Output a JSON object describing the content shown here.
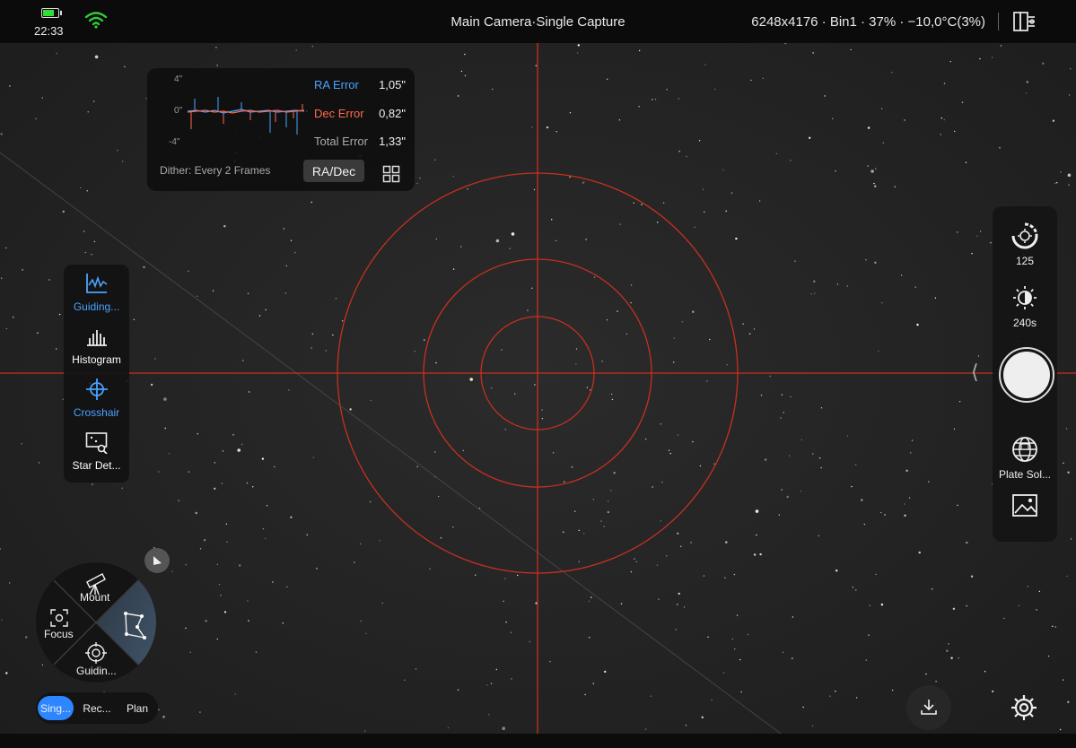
{
  "status": {
    "time": "22:33",
    "battery_level": 0.85,
    "battery_color": "#33dd33"
  },
  "header": {
    "title": "Main Camera·Single Capture",
    "camera_status": "6248x4176 · Bin1 · 37% · −10,0°C(3%)",
    "divider": "|"
  },
  "guiding": {
    "y_top": "4\"",
    "y_mid": "0\"",
    "y_bot": "-4\"",
    "ra_label": "RA Error",
    "ra_value": "1,05\"",
    "dec_label": "Dec Error",
    "dec_value": "0,82\"",
    "total_label": "Total Error",
    "total_value": "1,33\"",
    "dither": "Dither: Every 2 Frames",
    "mode_button": "RA/Dec",
    "ra_color": "#4aa3ff",
    "dec_color": "#ff6a4d"
  },
  "tools": {
    "items": [
      {
        "label": "Guiding...",
        "icon": "guiding-graph-icon",
        "active": true
      },
      {
        "label": "Histogram",
        "icon": "histogram-icon",
        "active": false
      },
      {
        "label": "Crosshair",
        "icon": "crosshair-icon",
        "active": true
      },
      {
        "label": "Star Det...",
        "icon": "star-detect-icon",
        "active": false
      }
    ]
  },
  "capture": {
    "gain": "125",
    "exposure": "240s",
    "plate_solve": "Plate Sol..."
  },
  "wheel": {
    "mount": "Mount",
    "focus": "Focus",
    "guiding": "Guidin..."
  },
  "modes": {
    "items": [
      {
        "label": "Sing...",
        "active": true
      },
      {
        "label": "Rec...",
        "active": false
      },
      {
        "label": "Plan",
        "active": false
      }
    ]
  },
  "overlay": {
    "crosshair_color": "#c8301e"
  }
}
